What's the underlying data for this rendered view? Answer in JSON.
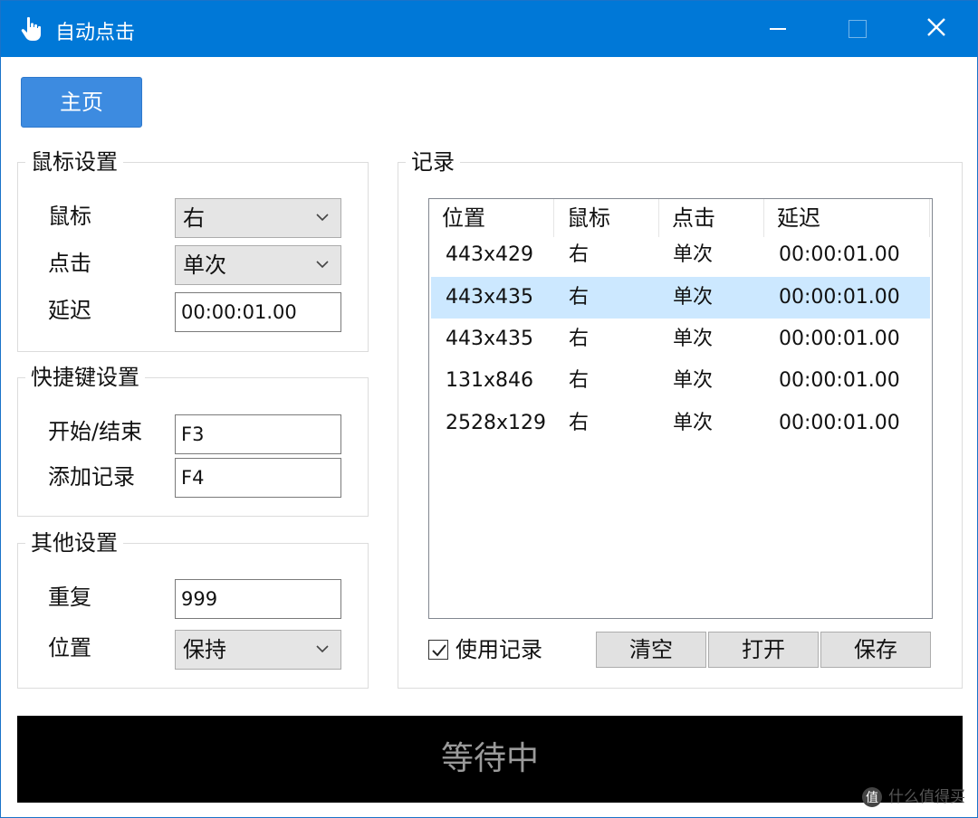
{
  "window": {
    "title": "自动点击",
    "accent_color": "#0078d7",
    "icons": {
      "app": "hand-pointer-icon",
      "minimize": "minimize-icon",
      "maximize": "maximize-icon",
      "close": "close-icon"
    }
  },
  "home_button": {
    "label": "主页",
    "color": "#3d8be0"
  },
  "mouse_settings": {
    "title": "鼠标设置",
    "mouse_label": "鼠标",
    "mouse_value": "右",
    "click_label": "点击",
    "click_value": "单次",
    "delay_label": "延迟",
    "delay_value": "00:00:01.00"
  },
  "hotkey_settings": {
    "title": "快捷键设置",
    "start_stop_label": "开始/结束",
    "start_stop_value": "F3",
    "add_record_label": "添加记录",
    "add_record_value": "F4"
  },
  "other_settings": {
    "title": "其他设置",
    "repeat_label": "重复",
    "repeat_value": "999",
    "position_label": "位置",
    "position_value": "保持"
  },
  "records": {
    "title": "记录",
    "columns": [
      "位置",
      "鼠标",
      "点击",
      "延迟"
    ],
    "rows": [
      {
        "position": "443x429",
        "mouse": "右",
        "click": "单次",
        "delay": "00:00:01.00",
        "selected": false
      },
      {
        "position": "443x435",
        "mouse": "右",
        "click": "单次",
        "delay": "00:00:01.00",
        "selected": true
      },
      {
        "position": "443x435",
        "mouse": "右",
        "click": "单次",
        "delay": "00:00:01.00",
        "selected": false
      },
      {
        "position": "131x846",
        "mouse": "右",
        "click": "单次",
        "delay": "00:00:01.00",
        "selected": false
      },
      {
        "position": "2528x129",
        "mouse": "右",
        "click": "单次",
        "delay": "00:00:01.00",
        "selected": false
      }
    ],
    "selected_row_color": "#cce8ff",
    "use_records_label": "使用记录",
    "use_records_checked": true,
    "clear_label": "清空",
    "open_label": "打开",
    "save_label": "保存"
  },
  "status": {
    "text": "等待中",
    "background": "#000000"
  },
  "watermark": {
    "text": "什么值得买"
  }
}
